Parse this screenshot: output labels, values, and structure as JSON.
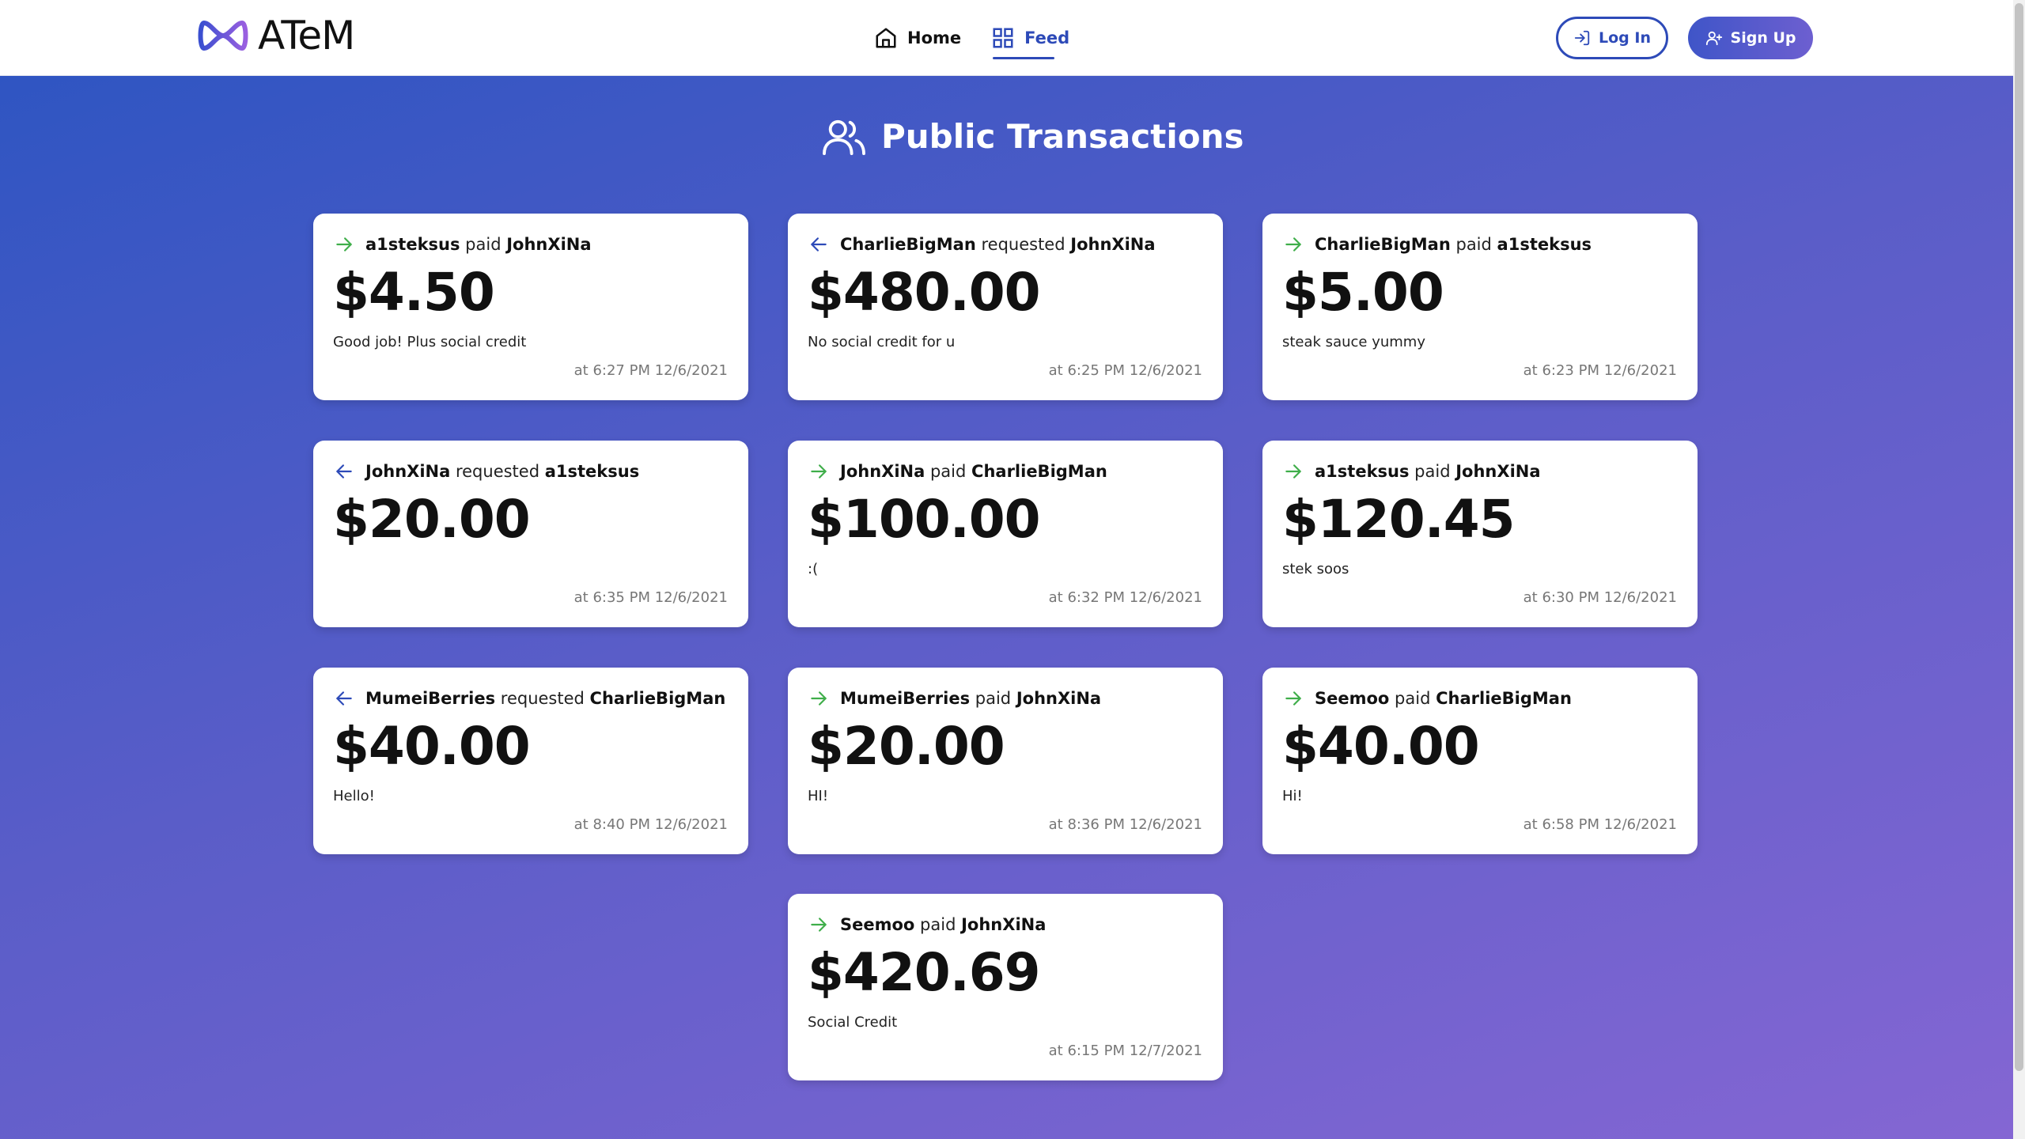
{
  "header": {
    "logo_text": "ATeM",
    "nav": [
      {
        "label": "Home",
        "icon": "home-icon"
      },
      {
        "label": "Feed",
        "icon": "grid-icon",
        "active": true
      }
    ],
    "login_label": "Log In",
    "signup_label": "Sign Up"
  },
  "colors": {
    "accent": "#2d4ab8",
    "paid_arrow": "#3fae4a",
    "requested_arrow": "#2d4ab8",
    "bg_start": "#2f55c2",
    "bg_end": "#8466d3"
  },
  "page": {
    "title": "Public Transactions",
    "title_icon": "users-icon"
  },
  "transactions": [
    {
      "from": "a1steksus",
      "verb": "paid",
      "to": "JohnXiNa",
      "amount": "$4.50",
      "note": "Good job! Plus social credit",
      "time": "at 6:27 PM 12/6/2021",
      "direction": "paid"
    },
    {
      "from": "CharlieBigMan",
      "verb": "requested",
      "to": "JohnXiNa",
      "amount": "$480.00",
      "note": "No social credit for u",
      "time": "at 6:25 PM 12/6/2021",
      "direction": "requested"
    },
    {
      "from": "CharlieBigMan",
      "verb": "paid",
      "to": "a1steksus",
      "amount": "$5.00",
      "note": "steak sauce yummy",
      "time": "at 6:23 PM 12/6/2021",
      "direction": "paid"
    },
    {
      "from": "JohnXiNa",
      "verb": "requested",
      "to": "a1steksus",
      "amount": "$20.00",
      "note": "",
      "time": "at 6:35 PM 12/6/2021",
      "direction": "requested"
    },
    {
      "from": "JohnXiNa",
      "verb": "paid",
      "to": "CharlieBigMan",
      "amount": "$100.00",
      "note": ":(",
      "time": "at 6:32 PM 12/6/2021",
      "direction": "paid"
    },
    {
      "from": "a1steksus",
      "verb": "paid",
      "to": "JohnXiNa",
      "amount": "$120.45",
      "note": "stek soos",
      "time": "at 6:30 PM 12/6/2021",
      "direction": "paid"
    },
    {
      "from": "MumeiBerries",
      "verb": "requested",
      "to": "CharlieBigMan",
      "amount": "$40.00",
      "note": "Hello!",
      "time": "at 8:40 PM 12/6/2021",
      "direction": "requested"
    },
    {
      "from": "MumeiBerries",
      "verb": "paid",
      "to": "JohnXiNa",
      "amount": "$20.00",
      "note": "HI!",
      "time": "at 8:36 PM 12/6/2021",
      "direction": "paid"
    },
    {
      "from": "Seemoo",
      "verb": "paid",
      "to": "CharlieBigMan",
      "amount": "$40.00",
      "note": "Hi!",
      "time": "at 6:58 PM 12/6/2021",
      "direction": "paid"
    },
    {
      "from": "Seemoo",
      "verb": "paid",
      "to": "JohnXiNa",
      "amount": "$420.69",
      "note": "Social Credit",
      "time": "at 6:15 PM 12/7/2021",
      "direction": "paid"
    }
  ]
}
